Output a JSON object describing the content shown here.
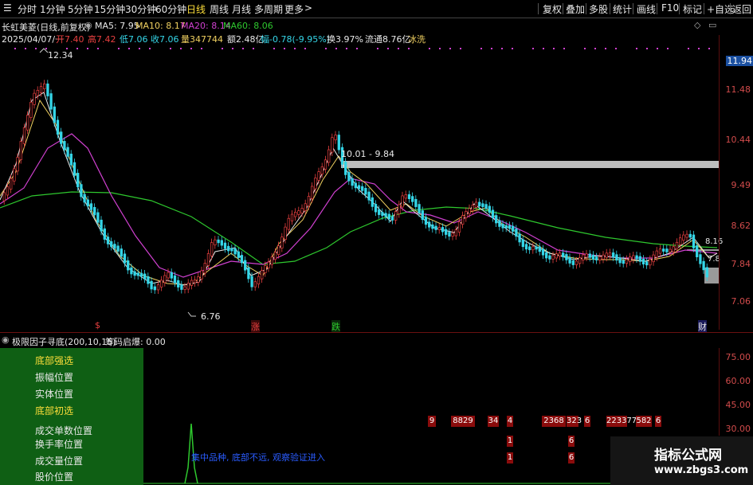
{
  "toolbar": {
    "periods": [
      "分时",
      "1分钟",
      "5分钟",
      "15分钟",
      "30分钟",
      "60分钟",
      "日线",
      "周线",
      "月线",
      "多周期",
      "更多"
    ],
    "active_period": "日线",
    "actions": [
      "复权",
      "叠加",
      "多股",
      "统计",
      "画线",
      "F10",
      "标记",
      "+自选",
      "返回"
    ]
  },
  "chart_header": {
    "title": "长虹美菱(日线,前复权)",
    "ma5": "MA5: 7.95",
    "ma10": "MA10: 8.17",
    "ma20": "MA20: 8.14",
    "ma60": "MA60: 8.06",
    "date": "2025/04/07/一",
    "open": "开7.40",
    "high": "高7.42",
    "low": "低7.06",
    "close": "收7.06",
    "volume": "量347744",
    "amount": "额2.48亿",
    "change": "幅-0.78(-9.95%)",
    "turnover": "换3.97%",
    "float": "流通8.76亿",
    "tag": "冰洗"
  },
  "price_axis": {
    "current": "11.94",
    "ticks": [
      "11.48",
      "10.44",
      "9.49",
      "8.62",
      "7.84",
      "7.06"
    ]
  },
  "annotations": {
    "high_price": "12.34",
    "low_price": "6.76",
    "range_label": "10.01 - 9.84",
    "level_816": "8.16",
    "level_78": "7.8"
  },
  "event_markers": [
    "$",
    "涨",
    "跌",
    "财"
  ],
  "indicator": {
    "title": "极限因子寻底(200,10,15)",
    "subtitle": "筹码启爆: 0.00",
    "rows": [
      "底部强选",
      "振幅位置",
      "实体位置",
      "底部初选",
      "成交单数位置",
      "换手率位置",
      "成交量位置",
      "股价位置"
    ],
    "axis_ticks": [
      "75.00",
      "60.00",
      "45.00",
      "30.00"
    ],
    "note": "集中品种, 底部不远, 观察验证进入",
    "bar_labels": [
      "9",
      "8829",
      "34",
      "4",
      "2368",
      "323",
      "6",
      "223377",
      "582",
      "6"
    ],
    "bar_labels_row2": [
      "1",
      "6"
    ],
    "bar_labels_row3": [
      "1",
      "6"
    ]
  },
  "watermark": {
    "line1": "指标公式网",
    "line2": "www.zbgs3.com"
  },
  "colors": {
    "up": "#e84040",
    "down": "#35d6e8",
    "ma5": "#e8e8e8",
    "ma10": "#f0d060",
    "ma20": "#d040d0",
    "ma60": "#2ec82e"
  }
}
